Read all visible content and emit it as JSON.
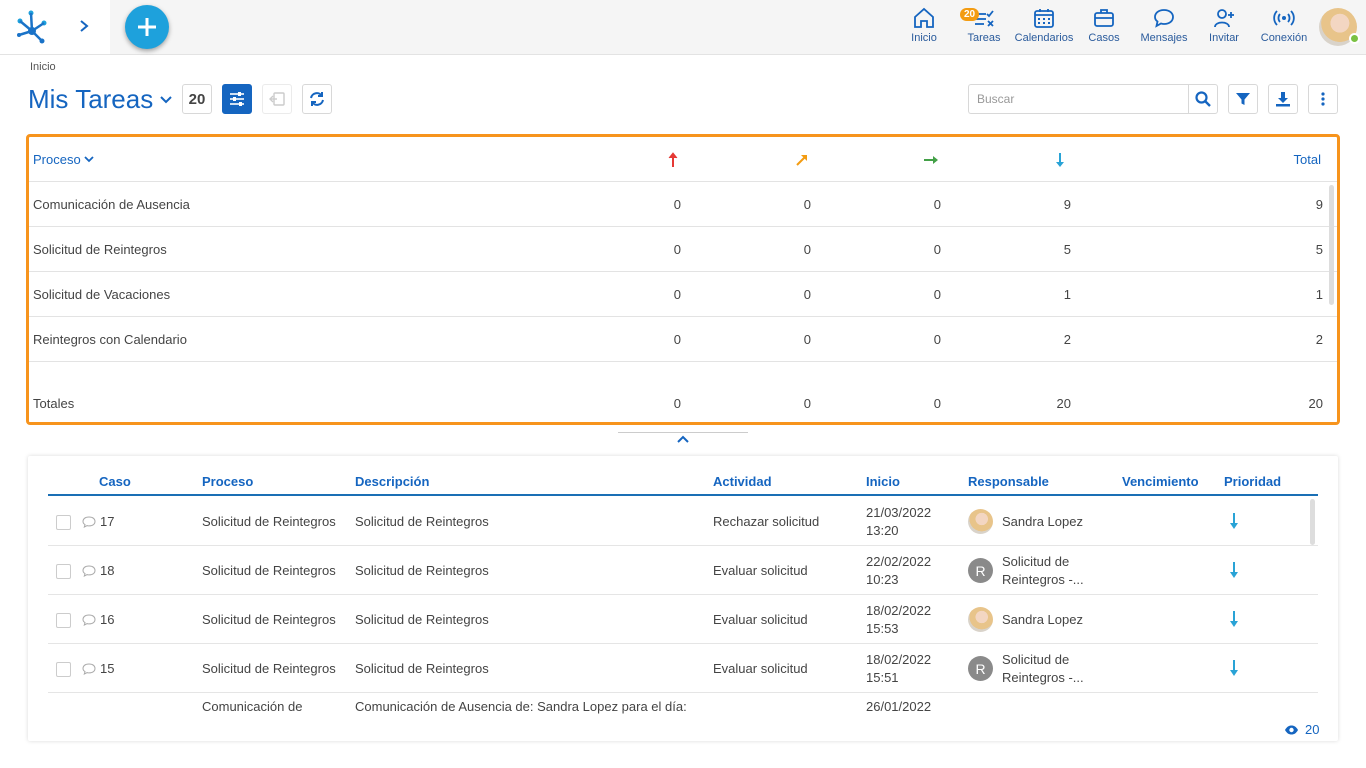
{
  "topnav": {
    "items": [
      {
        "label": "Inicio",
        "icon": "home-icon"
      },
      {
        "label": "Tareas",
        "icon": "tasks-icon",
        "badge": "20"
      },
      {
        "label": "Calendarios",
        "icon": "calendar-icon"
      },
      {
        "label": "Casos",
        "icon": "briefcase-icon"
      },
      {
        "label": "Mensajes",
        "icon": "chat-icon"
      },
      {
        "label": "Invitar",
        "icon": "add-user-icon"
      },
      {
        "label": "Conexión",
        "icon": "signal-icon"
      }
    ]
  },
  "breadcrumb": "Inicio",
  "page": {
    "title": "Mis Tareas",
    "count": "20"
  },
  "search": {
    "placeholder": "Buscar"
  },
  "colors": {
    "accent": "#1565c0",
    "highlight": "#f7941d",
    "brand": "#1ea1dc"
  },
  "summary": {
    "header": {
      "proceso": "Proceso",
      "total": "Total"
    },
    "priority_icons": [
      "arrow-up-red-icon",
      "arrow-up-right-orange-icon",
      "arrow-right-green-icon",
      "arrow-down-blue-icon"
    ],
    "rows": [
      {
        "name": "Comunicación de Ausencia",
        "p1": "0",
        "p2": "0",
        "p3": "0",
        "p4": "9",
        "total": "9"
      },
      {
        "name": "Solicitud de Reintegros",
        "p1": "0",
        "p2": "0",
        "p3": "0",
        "p4": "5",
        "total": "5"
      },
      {
        "name": "Solicitud de Vacaciones",
        "p1": "0",
        "p2": "0",
        "p3": "0",
        "p4": "1",
        "total": "1"
      },
      {
        "name": "Reintegros con Calendario",
        "p1": "0",
        "p2": "0",
        "p3": "0",
        "p4": "2",
        "total": "2"
      }
    ],
    "totals": {
      "name": "Totales",
      "p1": "0",
      "p2": "0",
      "p3": "0",
      "p4": "20",
      "total": "20"
    }
  },
  "tasks": {
    "columns": {
      "caso": "Caso",
      "proceso": "Proceso",
      "descripcion": "Descripción",
      "actividad": "Actividad",
      "inicio": "Inicio",
      "responsable": "Responsable",
      "vencimiento": "Vencimiento",
      "prioridad": "Prioridad"
    },
    "rows": [
      {
        "caso": "17",
        "proceso": "Solicitud de Reintegros",
        "descripcion": "Solicitud de Reintegros",
        "actividad": "Rechazar solicitud",
        "fecha": "21/03/2022",
        "hora": "13:20",
        "responsable1": "Sandra Lopez",
        "responsable2": "",
        "avatar": "photo",
        "avatar_letter": ""
      },
      {
        "caso": "18",
        "proceso": "Solicitud de Reintegros",
        "descripcion": "Solicitud de Reintegros",
        "actividad": "Evaluar solicitud",
        "fecha": "22/02/2022",
        "hora": "10:23",
        "responsable1": "Solicitud de",
        "responsable2": "Reintegros -...",
        "avatar": "letter",
        "avatar_letter": "R"
      },
      {
        "caso": "16",
        "proceso": "Solicitud de Reintegros",
        "descripcion": "Solicitud de Reintegros",
        "actividad": "Evaluar solicitud",
        "fecha": "18/02/2022",
        "hora": "15:53",
        "responsable1": "Sandra Lopez",
        "responsable2": "",
        "avatar": "photo",
        "avatar_letter": ""
      },
      {
        "caso": "15",
        "proceso": "Solicitud de Reintegros",
        "descripcion": "Solicitud de Reintegros",
        "actividad": "Evaluar solicitud",
        "fecha": "18/02/2022",
        "hora": "15:51",
        "responsable1": "Solicitud de",
        "responsable2": "Reintegros -...",
        "avatar": "letter",
        "avatar_letter": "R"
      }
    ],
    "partial_row": {
      "proceso": "Comunicación de",
      "descripcion": "Comunicación de Ausencia de: Sandra Lopez para el día:",
      "fecha": "26/01/2022"
    },
    "visible_count": "20"
  }
}
